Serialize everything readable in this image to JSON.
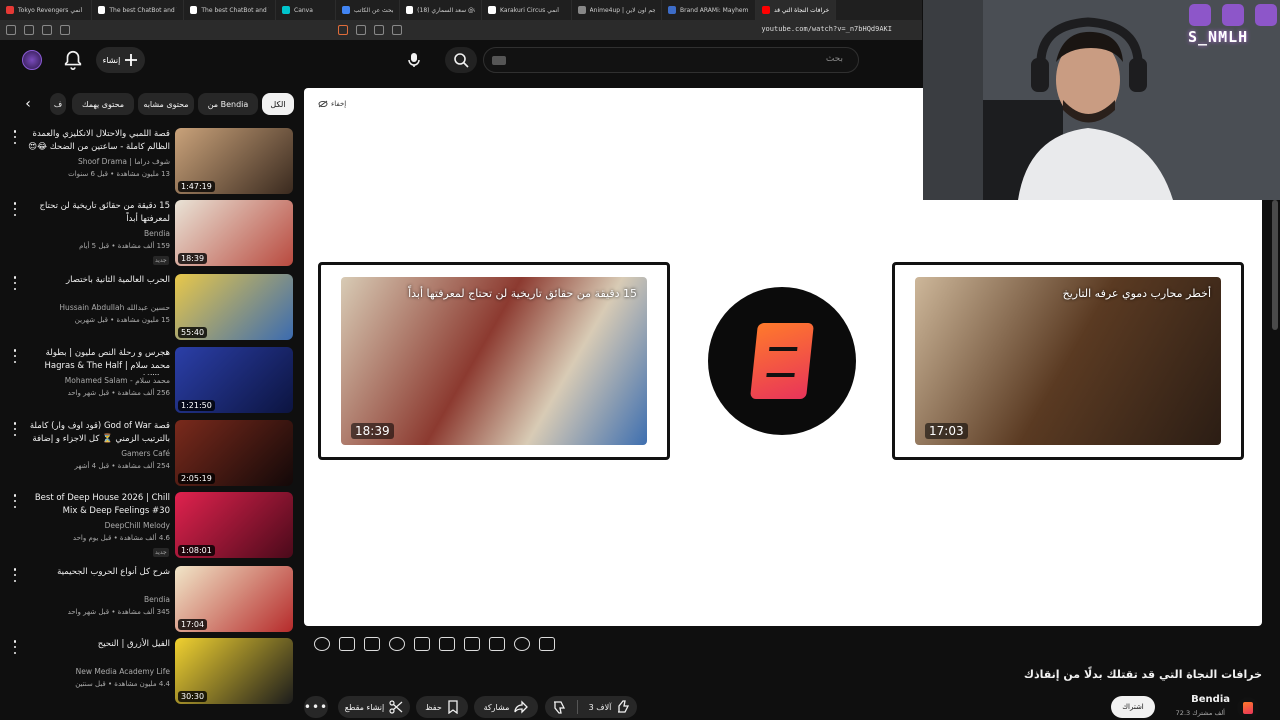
{
  "browser": {
    "tabs": [
      {
        "label": "Tokyo Revengers أنمي",
        "color": "#e53935"
      },
      {
        "label": "The best ChatBot and W",
        "color": "#ffffff"
      },
      {
        "label": "The best ChatBot and W",
        "color": "#ffffff"
      },
      {
        "label": "Canva",
        "color": "#00c4cc"
      },
      {
        "label": "بحث عن الكاتب",
        "color": "#4285f4"
      },
      {
        "label": "(18) سعد السماري @ari",
        "color": "#ffffff"
      },
      {
        "label": "Karakuri Circus أنمي",
        "color": "#ffffff"
      },
      {
        "label": "Anime4up | رجم اون لاين",
        "color": "#888888"
      },
      {
        "label": "Brand ARAMi: Mayhem",
        "color": "#3d6cc7"
      },
      {
        "label": "خرافات النجاة التي قد",
        "color": "#ff0000"
      }
    ],
    "url": "youtube.com/watch?v=_n7bHQd9AKI"
  },
  "masthead": {
    "create_label": "إنشاء",
    "search_placeholder": "بحث"
  },
  "chips": [
    {
      "label": "الكل",
      "active": true
    },
    {
      "label": "من Bendia",
      "active": false
    },
    {
      "label": "محتوى مشابه",
      "active": false
    },
    {
      "label": "محتوى يهمك",
      "active": false
    },
    {
      "label": "ف",
      "active": false
    }
  ],
  "recommendations": [
    {
      "title": "قصة اللمبي والاحتلال الانكليزي والعمدة الظالم كاملة - ساعتين من الضحك 😂😍 ...",
      "channel": "Shoof Drama | شوف دراما",
      "verified": true,
      "meta": "13 مليون مشاهدة • قبل 6 سنوات",
      "duration": "1:47:19",
      "thumb": [
        "#c9a27a",
        "#3a2a1f"
      ],
      "badge": ""
    },
    {
      "title": "15 دقيقة من حقائق تاريخية لن تحتاج لمعرفتها أبداً",
      "channel": "Bendia",
      "verified": false,
      "meta": "159 ألف مشاهدة • قبل 5 أيام",
      "duration": "18:39",
      "thumb": [
        "#e9e3d6",
        "#b94a3f"
      ],
      "badge": "جديد"
    },
    {
      "title": "الحرب العالمية الثانية باختصار",
      "channel": "Hussain Abdullah حسين عبدالله",
      "verified": true,
      "meta": "15 مليون مشاهدة • قبل شهرين",
      "duration": "55:40",
      "thumb": [
        "#e8c84a",
        "#3b6bb0"
      ],
      "badge": ""
    },
    {
      "title": "هجرس و رحلة النص مليون | بطولة محمد سلام | Hagras & The Half Million",
      "channel": "Mohamed Salam - محمد سلام",
      "verified": false,
      "meta": "256 ألف مشاهدة • قبل شهر واحد",
      "duration": "1:21:50",
      "thumb": [
        "#2b3fa8",
        "#0c1440"
      ],
      "badge": ""
    },
    {
      "title": "قصة God of War (قود اوف وار) كاملة بالترتيب الزمني ⏳ كل الاجزاء و إضافة ...",
      "channel": "Gamers Café",
      "verified": false,
      "meta": "254 ألف مشاهدة • قبل 4 أشهر",
      "duration": "2:05:19",
      "thumb": [
        "#7a2a1c",
        "#120808"
      ],
      "badge": ""
    },
    {
      "title": "Best of Deep House 2026 | Chill Mix & Deep Feelings #30",
      "channel": "DeepChill Melody",
      "verified": false,
      "meta": "4.6 ألف مشاهدة • قبل يوم واحد",
      "duration": "1:08:01",
      "thumb": [
        "#e0224e",
        "#4a0a1a"
      ],
      "badge": "جديد"
    },
    {
      "title": "شرح كل أنواع الحروب الجحيمية",
      "channel": "Bendia",
      "verified": false,
      "meta": "345 ألف مشاهدة • قبل شهر واحد",
      "duration": "17:04",
      "thumb": [
        "#f1e6c8",
        "#b62b2b"
      ],
      "badge": ""
    },
    {
      "title": "الفيل الأزرق | النحيح",
      "channel": "New Media Academy Life",
      "verified": true,
      "meta": "4.4 مليون مشاهدة • قبل سنتين",
      "duration": "30:30",
      "thumb": [
        "#f0d130",
        "#1c1c1c"
      ],
      "badge": ""
    }
  ],
  "player": {
    "hide_label": "إخفاء",
    "endcard_left": {
      "title": "15 دقيقة من حقائق تاريخية لن تحتاج لمعرفتها أبداً",
      "duration": "18:39",
      "colors": [
        "#d8cbb5",
        "#8c3a30"
      ]
    },
    "endcard_right": {
      "title": "أخطر محارب دموي عرفه التاريخ",
      "duration": "17:03",
      "colors": [
        "#cdb79a",
        "#5a3a22"
      ]
    }
  },
  "video": {
    "title": "خرافات النجاة التي قد تقتلك بدلًا من إنقاذك",
    "channel_name": "Bendia",
    "subscribers": "72.3 ألف مشترك",
    "subscribe_label": "اشتراك",
    "like_count": "3 آلاف",
    "share_label": "مشاركة",
    "save_label": "حفظ",
    "clip_label": "إنشاء مقطع"
  },
  "webcam": {
    "watermark": "S_NMLH"
  },
  "colors": {
    "accent": "#ff0033",
    "background": "#0f0f0f",
    "chip_bg": "#272727"
  }
}
